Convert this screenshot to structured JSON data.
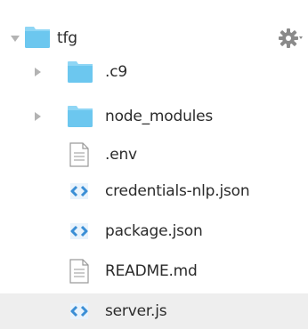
{
  "tree": {
    "root": {
      "label": "tfg",
      "icon": "folder-icon",
      "expanded": true
    },
    "settings_icon": "gear-icon",
    "items": [
      {
        "label": ".c9",
        "icon": "folder-icon",
        "type": "folder",
        "expanded": false
      },
      {
        "label": "node_modules",
        "icon": "folder-icon",
        "type": "folder",
        "expanded": false
      },
      {
        "label": ".env",
        "icon": "text-file-icon",
        "type": "file"
      },
      {
        "label": "credentials-nlp.json",
        "icon": "code-file-icon",
        "type": "file"
      },
      {
        "label": "package.json",
        "icon": "code-file-icon",
        "type": "file"
      },
      {
        "label": "README.md",
        "icon": "text-file-icon",
        "type": "file"
      },
      {
        "label": "server.js",
        "icon": "code-file-icon",
        "type": "file",
        "selected": true
      }
    ]
  },
  "colors": {
    "folder": "#6cc7ef",
    "folder_tab": "#8fd6f5",
    "arrow": "#b3b3b3",
    "code_icon": "#3b8fd6",
    "selection": "#eeeeee",
    "text": "#2b2b2b"
  }
}
